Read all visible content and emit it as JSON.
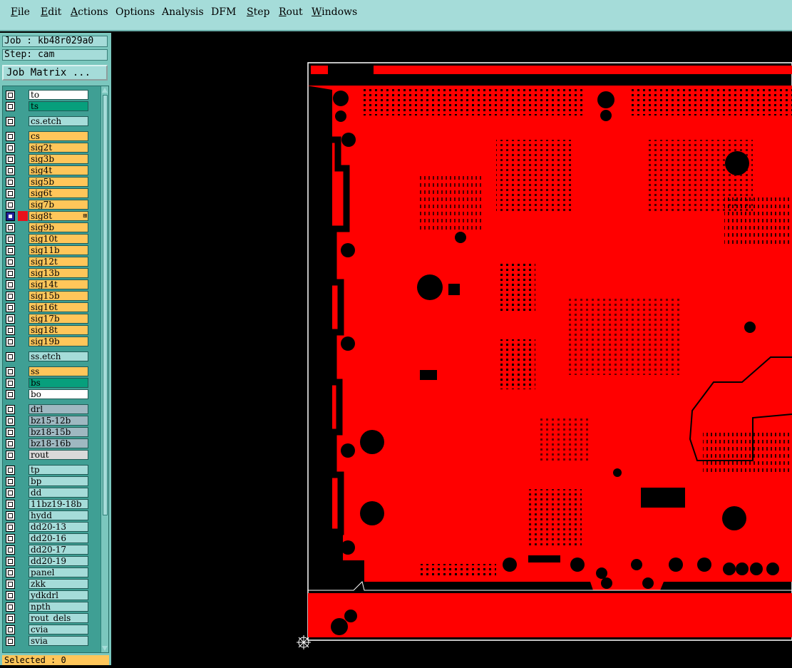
{
  "menubar": {
    "items": [
      {
        "label": "File",
        "underline": "F",
        "rest": "ile"
      },
      {
        "label": "Edit",
        "underline": "E",
        "rest": "dit"
      },
      {
        "label": "Actions",
        "underline": "A",
        "rest": "ctions"
      },
      {
        "label": "Options",
        "underline": "",
        "rest": "Options"
      },
      {
        "label": "Analysis",
        "underline": "",
        "rest": "Analysis"
      },
      {
        "label": "DFM",
        "underline": "",
        "rest": "DFM"
      },
      {
        "label": "Step",
        "underline": "S",
        "rest": "tep"
      },
      {
        "label": "Rout",
        "underline": "R",
        "rest": "out"
      },
      {
        "label": "Windows",
        "underline": "W",
        "rest": "indows"
      }
    ]
  },
  "sidebar": {
    "job": "Job : kb48r029a0",
    "step": "Step: cam",
    "matrix_button": "Job Matrix ...",
    "selected": "Selected : 0"
  },
  "layers": [
    {
      "name": "to",
      "color": "white"
    },
    {
      "name": "ts",
      "color": "green"
    },
    {
      "name": "cs.etch",
      "color": "cyan",
      "gap": true
    },
    {
      "name": "cs",
      "color": "orange",
      "gap": true
    },
    {
      "name": "sig2t",
      "color": "orange"
    },
    {
      "name": "sig3b",
      "color": "orange"
    },
    {
      "name": "sig4t",
      "color": "orange"
    },
    {
      "name": "sig5b",
      "color": "orange"
    },
    {
      "name": "sig6t",
      "color": "orange"
    },
    {
      "name": "sig7b",
      "color": "orange"
    },
    {
      "name": "sig8t",
      "color": "orange",
      "active": true,
      "mark": "⊞"
    },
    {
      "name": "sig9b",
      "color": "orange"
    },
    {
      "name": "sig10t",
      "color": "orange"
    },
    {
      "name": "sig11b",
      "color": "orange"
    },
    {
      "name": "sig12t",
      "color": "orange"
    },
    {
      "name": "sig13b",
      "color": "orange"
    },
    {
      "name": "sig14t",
      "color": "orange"
    },
    {
      "name": "sig15b",
      "color": "orange"
    },
    {
      "name": "sig16t",
      "color": "orange"
    },
    {
      "name": "sig17b",
      "color": "orange"
    },
    {
      "name": "sig18t",
      "color": "orange"
    },
    {
      "name": "sig19b",
      "color": "orange"
    },
    {
      "name": "ss.etch",
      "color": "cyan",
      "gap": true
    },
    {
      "name": "ss",
      "color": "orange",
      "gap": true
    },
    {
      "name": "bs",
      "color": "green"
    },
    {
      "name": "bo",
      "color": "white"
    },
    {
      "name": "drl",
      "color": "gray",
      "gap": true
    },
    {
      "name": "bz15-12b",
      "color": "gray"
    },
    {
      "name": "bz18-15b",
      "color": "gray"
    },
    {
      "name": "bz18-16b",
      "color": "gray"
    },
    {
      "name": "rout",
      "color": "lgray"
    },
    {
      "name": "tp",
      "color": "cyan",
      "gap": true
    },
    {
      "name": "bp",
      "color": "cyan"
    },
    {
      "name": "dd",
      "color": "cyan"
    },
    {
      "name": "11bz19-18b",
      "color": "cyan"
    },
    {
      "name": "hydd",
      "color": "cyan"
    },
    {
      "name": "dd20-13",
      "color": "cyan"
    },
    {
      "name": "dd20-16",
      "color": "cyan"
    },
    {
      "name": "dd20-17",
      "color": "cyan"
    },
    {
      "name": "dd20-19",
      "color": "cyan"
    },
    {
      "name": "panel",
      "color": "cyan"
    },
    {
      "name": "zkk",
      "color": "cyan"
    },
    {
      "name": "ydkdrl",
      "color": "cyan"
    },
    {
      "name": "npth",
      "color": "cyan"
    },
    {
      "name": "rout_dels",
      "color": "cyan"
    },
    {
      "name": "cvia",
      "color": "cyan"
    },
    {
      "name": "svia",
      "color": "cyan"
    }
  ],
  "colors": {
    "board": "#ff0000",
    "background": "#000000",
    "outline": "#ffffff",
    "menubar": "#a5dcd9",
    "panel": "#7bc7be"
  }
}
